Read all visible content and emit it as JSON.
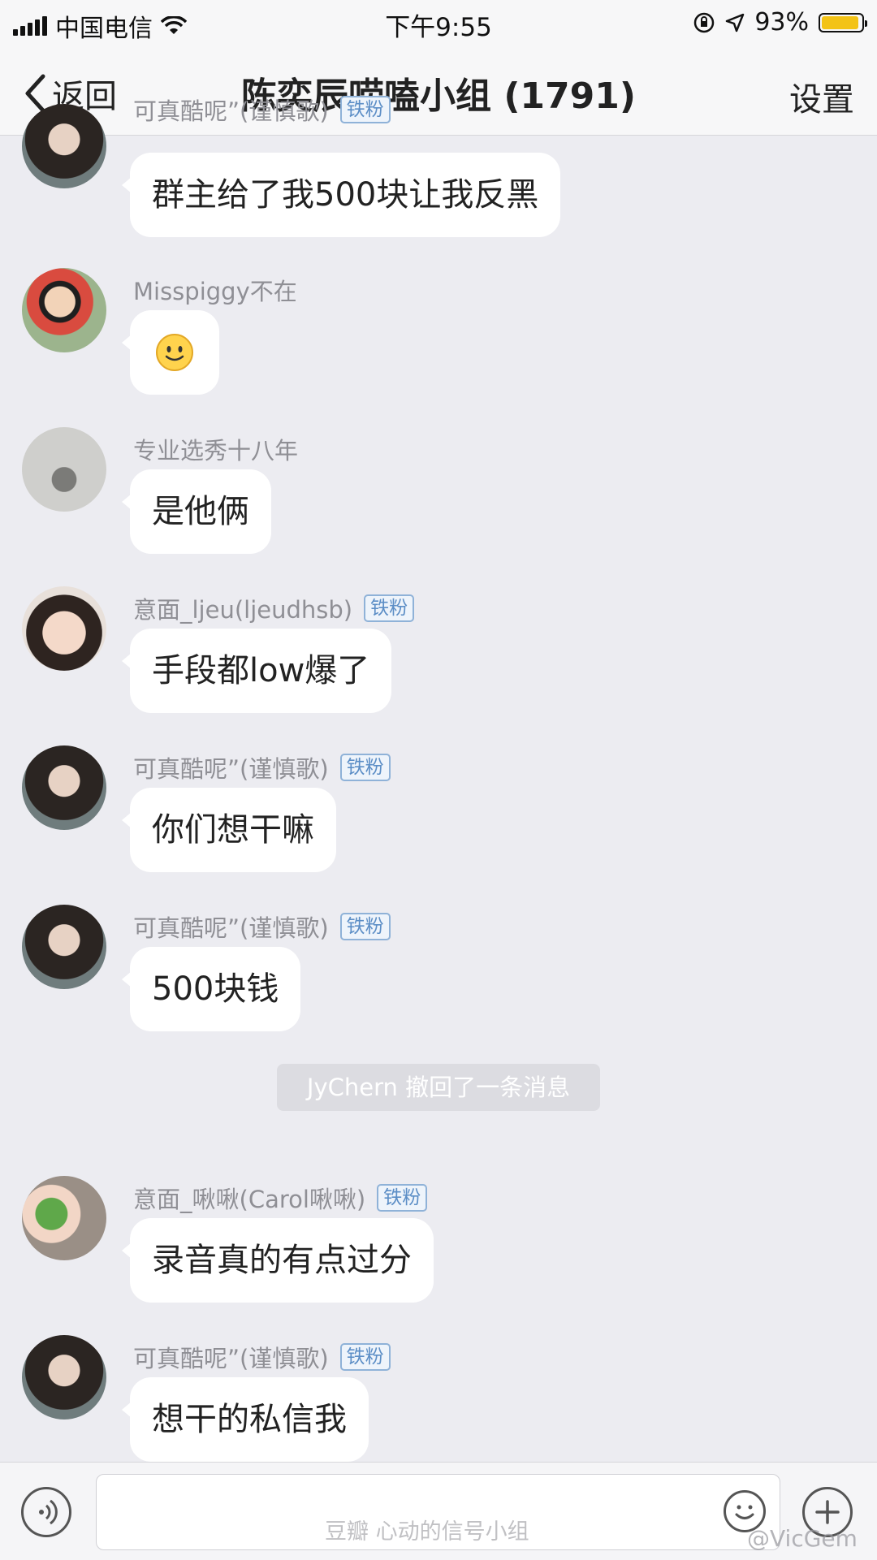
{
  "status_bar": {
    "carrier": "中国电信",
    "time": "下午9:55",
    "battery_text": "93%",
    "battery_level": 0.93,
    "battery_color": "#f3c316",
    "icons": [
      "signal-icon",
      "wifi-icon",
      "orientation-lock-icon",
      "location-icon",
      "battery-icon"
    ]
  },
  "nav": {
    "back_label": "返回",
    "title": "陈奕辰唠嗑小组 (1791)",
    "settings_label": "设置"
  },
  "messages": [
    {
      "sender": "可真酷呢”(谨慎歌)",
      "badge": "铁粉",
      "text": "群主给了我500块让我反黑",
      "avatar": "avatar-girl-hat"
    },
    {
      "sender": "Misspiggy不在",
      "badge": "",
      "text": "",
      "emoji": "smiley-emoji",
      "avatar": "avatar-cartoon-boy"
    },
    {
      "sender": "专业选秀十八年",
      "badge": "",
      "text": "是他俩",
      "avatar": "avatar-handbag"
    },
    {
      "sender": "意面_ljeu(ljeudhsb)",
      "badge": "铁粉",
      "text": "手段都low爆了",
      "avatar": "avatar-child-face"
    },
    {
      "sender": "可真酷呢”(谨慎歌)",
      "badge": "铁粉",
      "text": "你们想干嘛",
      "avatar": "avatar-girl-hat"
    },
    {
      "sender": "可真酷呢”(谨慎歌)",
      "badge": "铁粉",
      "text": "500块钱",
      "avatar": "avatar-girl-hat"
    },
    {
      "sender": "意面_啾啾(Carol啾啾)",
      "badge": "铁粉",
      "text": "录音真的有点过分",
      "avatar": "avatar-watermelon-hat"
    },
    {
      "sender": "可真酷呢”(谨慎歌)",
      "badge": "铁粉",
      "text": "想干的私信我",
      "avatar": "avatar-girl-hat"
    }
  ],
  "recall_notice": "JyChern 撤回了一条消息",
  "input_bar": {
    "placeholder": "",
    "icons": [
      "voice-icon",
      "emoji-icon",
      "plus-icon"
    ]
  },
  "watermarks": {
    "center": "豆瓣  心动的信号小组",
    "right": "@VicGem"
  }
}
